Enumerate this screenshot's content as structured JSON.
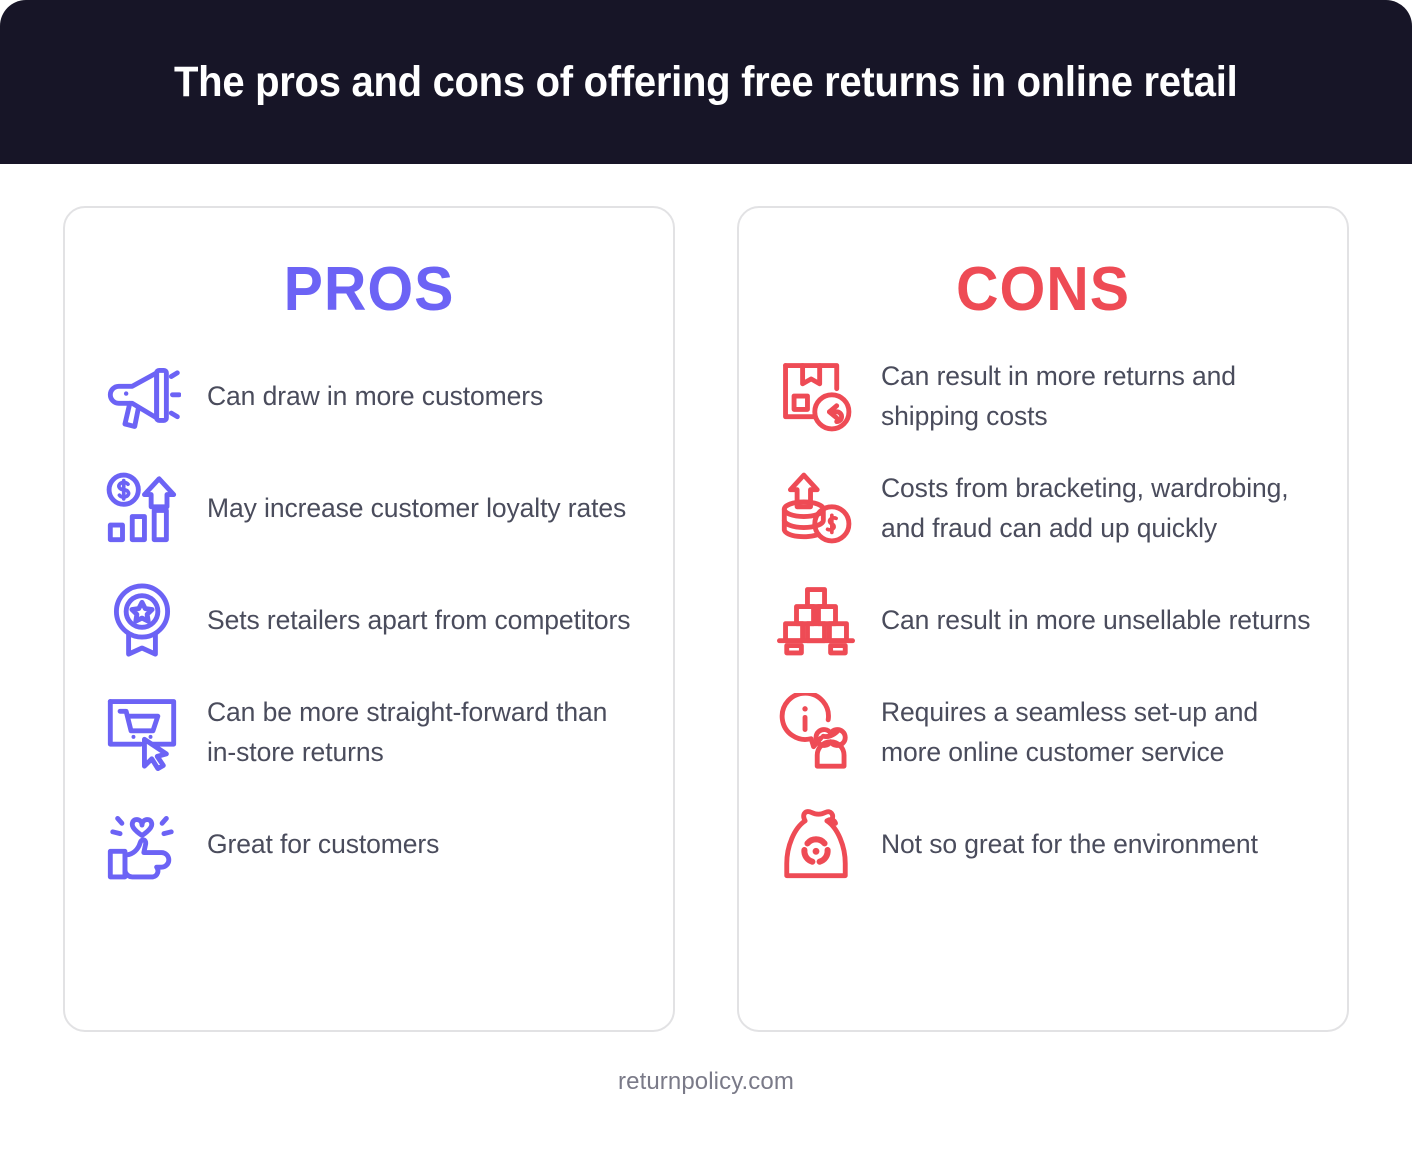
{
  "header": {
    "title": "The pros and cons of offering free returns in online retail",
    "background_color": "#171527",
    "text_color": "#ffffff"
  },
  "pros": {
    "title": "PROS",
    "accent_color": "#6c63f5",
    "items": [
      {
        "icon": "megaphone-icon",
        "text": "Can draw in more customers"
      },
      {
        "icon": "money-growth-chart-icon",
        "text": "May increase customer loyalty rates"
      },
      {
        "icon": "award-ribbon-icon",
        "text": "Sets retailers apart from competitors"
      },
      {
        "icon": "online-cart-cursor-icon",
        "text": "Can be more straight-forward than in-store returns"
      },
      {
        "icon": "thumbs-up-heart-icon",
        "text": "Great for customers"
      }
    ]
  },
  "cons": {
    "title": "CONS",
    "accent_color": "#ee4b55",
    "items": [
      {
        "icon": "package-return-icon",
        "text": "Can result in more returns and shipping costs"
      },
      {
        "icon": "rising-coins-icon",
        "text": "Costs from bracketing, wardrobing, and fraud can add up quickly"
      },
      {
        "icon": "stacked-boxes-icon",
        "text": "Can result in more unsellable returns"
      },
      {
        "icon": "info-customer-service-icon",
        "text": "Requires a seamless set-up and more online customer service"
      },
      {
        "icon": "waste-bag-icon",
        "text": "Not so great for the environment"
      }
    ]
  },
  "footer": {
    "source": "returnpolicy.com",
    "text_color": "#7a7a88"
  }
}
